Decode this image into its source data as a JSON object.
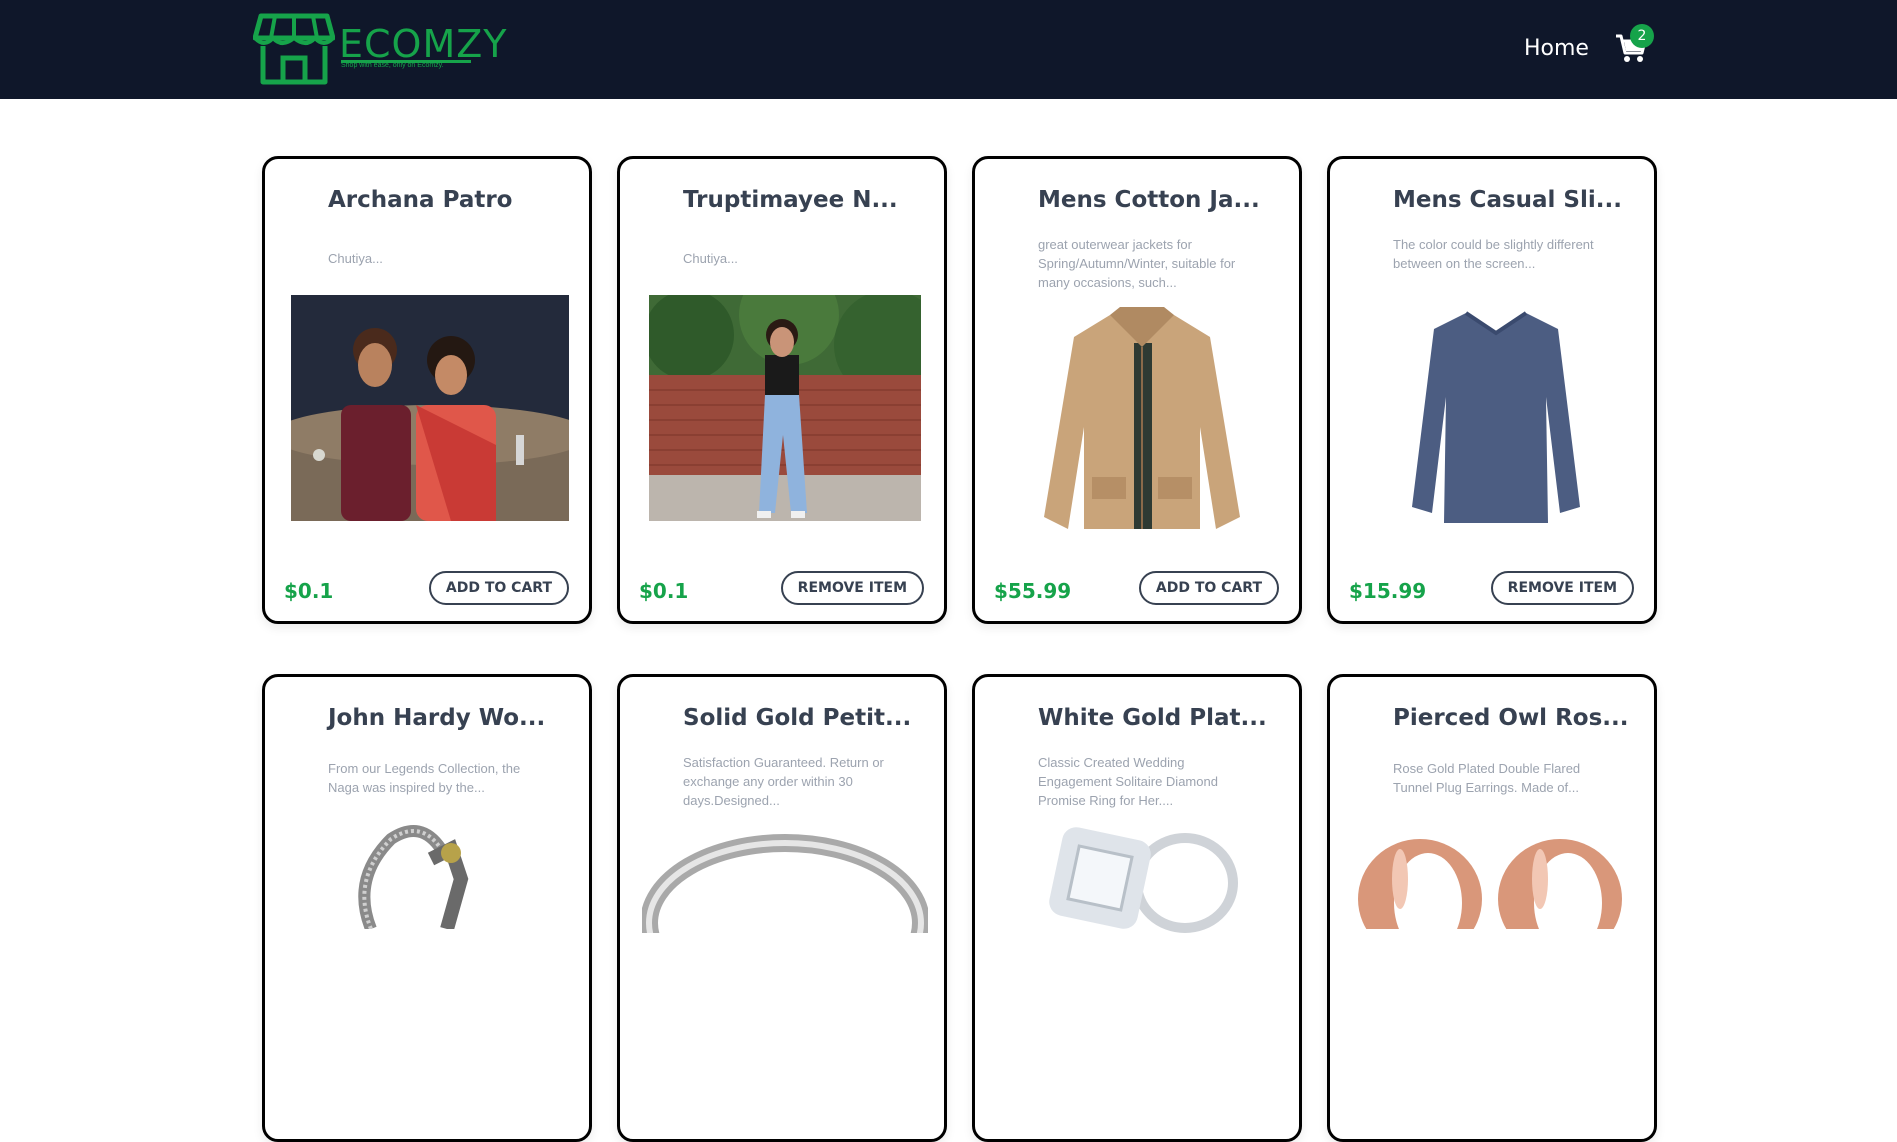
{
  "brand": {
    "name": "ECOMZY",
    "tagline": "Shop with ease, only on Ecomzy.",
    "color": "#16a34a"
  },
  "nav": {
    "home_label": "Home",
    "cart_icon": "cart-icon",
    "cart_count": "2"
  },
  "colors": {
    "navbar_bg": "#0f172a",
    "accent": "#16a34a",
    "text": "#374151"
  },
  "products": [
    {
      "title": "Archana Patro",
      "description": "Chutiya...",
      "price": "$0.1",
      "button": "ADD TO CART",
      "image": "couple-photo"
    },
    {
      "title": "Truptimayee N...",
      "description": "Chutiya...",
      "price": "$0.1",
      "button": "REMOVE ITEM",
      "image": "woman-photo"
    },
    {
      "title": "Mens Cotton Ja...",
      "description": "great outerwear jackets for Spring/Autumn/Winter, suitable for many occasions, such...",
      "price": "$55.99",
      "button": "ADD TO CART",
      "image": "jacket"
    },
    {
      "title": "Mens Casual Sli...",
      "description": "The color could be slightly different between on the screen...",
      "price": "$15.99",
      "button": "REMOVE ITEM",
      "image": "tshirt"
    },
    {
      "title": "John Hardy Wo...",
      "description": "From our Legends Collection, the Naga was inspired by the...",
      "price": "",
      "button": "",
      "image": "bracelet"
    },
    {
      "title": "Solid Gold Petit...",
      "description": "Satisfaction Guaranteed. Return or exchange any order within 30 days.Designed...",
      "price": "",
      "button": "",
      "image": "ring"
    },
    {
      "title": "White Gold Plat...",
      "description": "Classic Created Wedding Engagement Solitaire Diamond Promise Ring for Her....",
      "price": "",
      "button": "",
      "image": "diamond-ring"
    },
    {
      "title": "Pierced Owl Ros...",
      "description": "Rose Gold Plated Double Flared Tunnel Plug Earrings. Made of...",
      "price": "",
      "button": "",
      "image": "plugs"
    }
  ]
}
